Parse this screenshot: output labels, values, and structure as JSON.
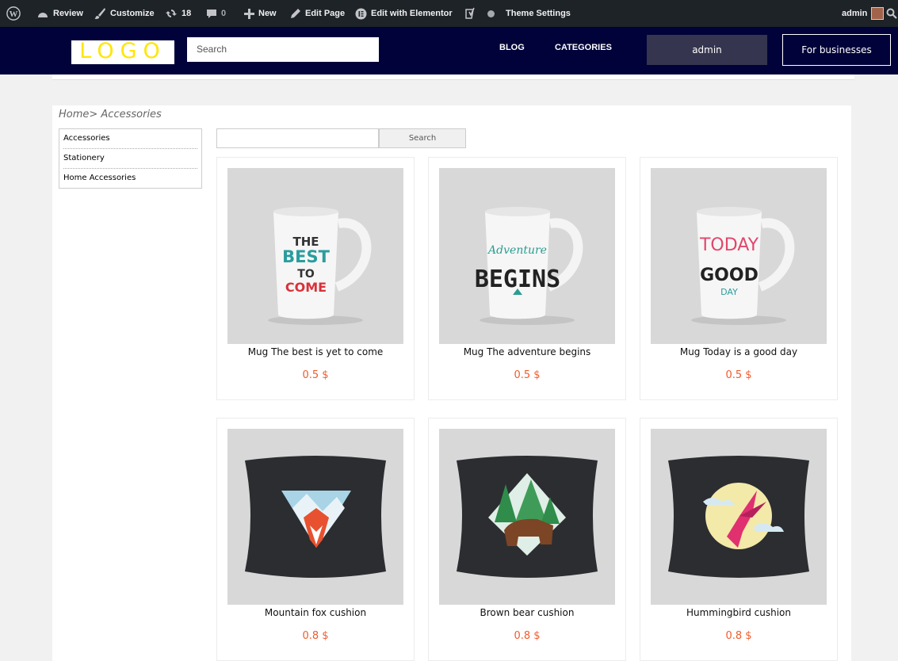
{
  "adminbar": {
    "review": "Review",
    "customize": "Customize",
    "updates_count": "18",
    "comments_count": "0",
    "new": "New",
    "edit_page": "Edit Page",
    "edit_elementor": "Edit with Elementor",
    "theme_settings": "Theme Settings",
    "user": "admin"
  },
  "header": {
    "logo_text": "LOGO",
    "search_placeholder": "Search",
    "nav": [
      "BLOG",
      "CATEGORIES"
    ],
    "admin_button": "admin",
    "business_button": "For businesses"
  },
  "breadcrumb": "Home> Accessories",
  "sidebar": {
    "items": [
      "Accessories",
      "Stationery",
      "Home Accessories"
    ]
  },
  "category_search": {
    "button": "Search"
  },
  "products": [
    {
      "title": "Mug The best is yet to come",
      "price": "0.5 $"
    },
    {
      "title": "Mug The adventure begins",
      "price": "0.5 $"
    },
    {
      "title": "Mug Today is a good day",
      "price": "0.5 $"
    },
    {
      "title": "Mountain fox cushion",
      "price": "0.8 $"
    },
    {
      "title": "Brown bear cushion",
      "price": "0.8 $"
    },
    {
      "title": "Hummingbird cushion",
      "price": "0.8 $"
    }
  ],
  "colors": {
    "header_bg": "#02023a",
    "price": "#f45a2a",
    "logo": "#ffe600"
  }
}
